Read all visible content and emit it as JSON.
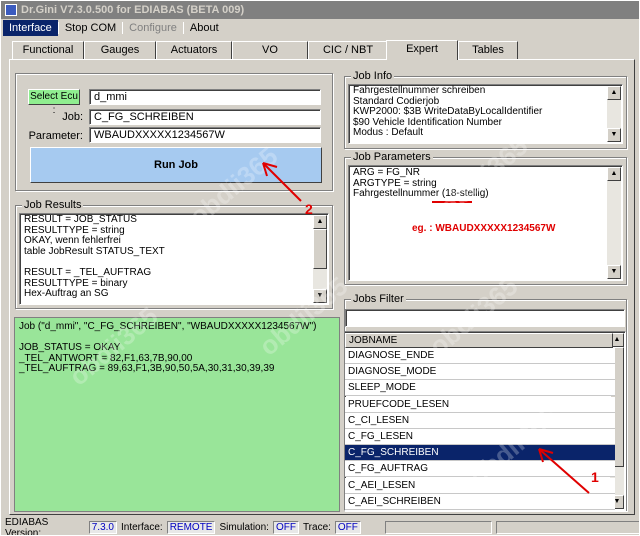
{
  "title": "Dr.Gini V7.3.0.500 for EDIABAS (BETA 009)",
  "menu": [
    "Interface",
    "Stop COM",
    "Configure",
    "About"
  ],
  "tabs": [
    "Functional",
    "Gauges",
    "Actuators",
    "VO",
    "CIC / NBT",
    "Expert",
    "Tables"
  ],
  "active_tab": "Expert",
  "select_ecu": {
    "button": "Select Ecu :",
    "value": "d_mmi"
  },
  "job": {
    "label": "Job:",
    "value": "C_FG_SCHREIBEN"
  },
  "parameter": {
    "label": "Parameter:",
    "value": "WBAUDXXXXX1234567W"
  },
  "run_job": "Run Job",
  "job_results": {
    "label": "Job Results",
    "lines": [
      "RESULT = JOB_STATUS",
      "RESULTTYPE = string",
      " OKAY, wenn fehlerfrei",
      " table JobResult STATUS_TEXT",
      "",
      "RESULT = _TEL_AUFTRAG",
      "RESULTTYPE = binary",
      " Hex-Auftrag an SG"
    ]
  },
  "output": {
    "lines": [
      "Job (\"d_mmi\", \"C_FG_SCHREIBEN\", \"WBAUDXXXXX1234567W\")",
      "",
      "JOB_STATUS = OKAY",
      "_TEL_ANTWORT = 82,F1,63,7B,90,00",
      "_TEL_AUFTRAG = 89,63,F1,3B,90,50,5A,30,31,30,39,39"
    ]
  },
  "job_info": {
    "label": "Job Info",
    "lines": [
      "Fahrgestellnummer schreiben",
      "Standard Codierjob",
      "KWP2000: $3B WriteDataByLocalIdentifier",
      "$90 Vehicle Identification Number",
      "Modus  : Default"
    ]
  },
  "job_parameters": {
    "label": "Job Parameters",
    "lines": [
      "ARG = FG_NR",
      "ARGTYPE = string",
      "Fahrgestellnummer (18-stellig)"
    ],
    "note": "eg. : WBAUDXXXXX1234567W"
  },
  "jobs_filter": {
    "label": "Jobs Filter",
    "value": ""
  },
  "jobs_list": {
    "header": "JOBNAME",
    "items": [
      "DIAGNOSE_ENDE",
      "DIAGNOSE_MODE",
      "SLEEP_MODE",
      "PRUEFCODE_LESEN",
      "C_CI_LESEN",
      "C_FG_LESEN",
      "C_FG_SCHREIBEN",
      "C_FG_AUFTRAG",
      "C_AEI_LESEN",
      "C_AEI_SCHREIBEN"
    ],
    "selected": "C_FG_SCHREIBEN"
  },
  "annotations": {
    "one": "1",
    "two": "2"
  },
  "watermark": "obdii365",
  "status": {
    "ediabas_label": "EDIABAS Version:",
    "ediabas_value": "7.3.0",
    "interface_label": "Interface:",
    "interface_value": "REMOTE",
    "simulation_label": "Simulation:",
    "simulation_value": "OFF",
    "trace_label": "Trace:",
    "trace_value": "OFF"
  },
  "colors": {
    "accent": "#0a246a",
    "output_bg": "#99e599",
    "run_button": "#a6caf0",
    "annotation": "#e00000"
  }
}
